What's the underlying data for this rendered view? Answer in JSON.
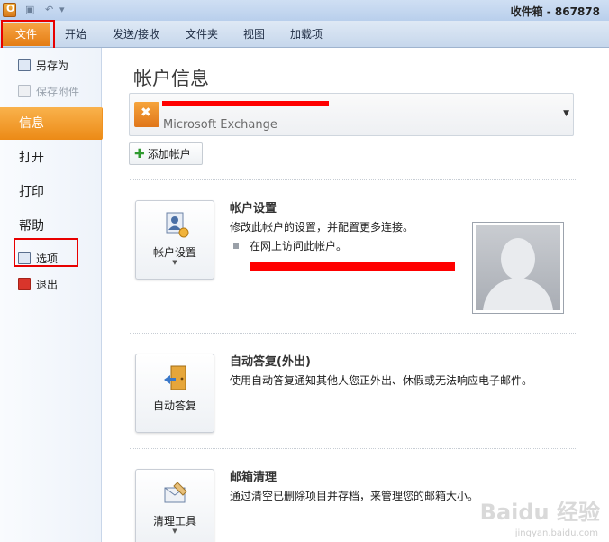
{
  "window": {
    "title": "收件箱 - 867878"
  },
  "ribbon": {
    "tabs": [
      "文件",
      "开始",
      "发送/接收",
      "文件夹",
      "视图",
      "加载项"
    ]
  },
  "leftnav": {
    "save_as": "另存为",
    "save_attachments": "保存附件",
    "info": "信息",
    "open": "打开",
    "print": "打印",
    "help": "帮助",
    "options": "选项",
    "exit": "退出"
  },
  "main": {
    "title": "帐户信息",
    "account_type": "Microsoft Exchange",
    "add_account": "添加帐户",
    "account_settings": {
      "button": "帐户设置",
      "title": "帐户设置",
      "desc": "修改此帐户的设置，并配置更多连接。",
      "bullet": "在网上访问此帐户。"
    },
    "auto_reply": {
      "button": "自动答复",
      "title": "自动答复(外出)",
      "desc": "使用自动答复通知其他人您正外出、休假或无法响应电子邮件。"
    },
    "cleanup": {
      "button": "清理工具",
      "title": "邮箱清理",
      "desc": "通过清空已删除项目并存档，来管理您的邮箱大小。"
    }
  },
  "watermark": {
    "main": "Baidu 经验",
    "sub": "jingyan.baidu.com"
  },
  "colors": {
    "accent": "#ef8d1a",
    "highlight_box": "#e80000"
  }
}
